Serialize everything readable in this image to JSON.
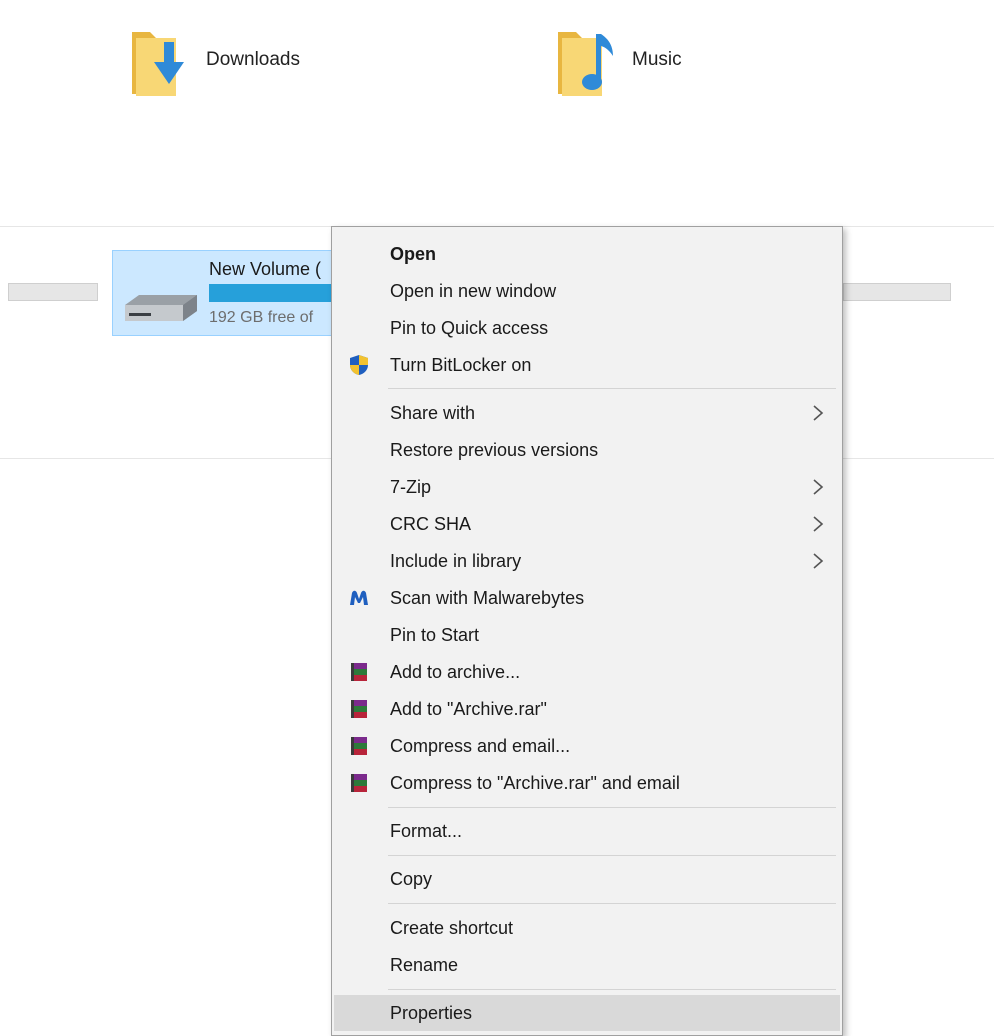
{
  "folders": [
    {
      "label": "Downloads",
      "icon": "downloads-folder-icon"
    },
    {
      "label": "Music",
      "icon": "music-folder-icon"
    }
  ],
  "drive": {
    "name": "New Volume (",
    "free_text": "192 GB free of",
    "icon": "hard-drive-icon",
    "used_fraction": 0.6
  },
  "context_menu": {
    "items": [
      {
        "label": "Open",
        "bold": true
      },
      {
        "label": "Open in new window"
      },
      {
        "label": "Pin to Quick access"
      },
      {
        "label": "Turn BitLocker on",
        "icon": "bitlocker-shield-icon"
      },
      {
        "label": "Share with",
        "submenu": true
      },
      {
        "label": "Restore previous versions"
      },
      {
        "label": "7-Zip",
        "submenu": true
      },
      {
        "label": "CRC SHA",
        "submenu": true
      },
      {
        "label": "Include in library",
        "submenu": true
      },
      {
        "label": "Scan with Malwarebytes",
        "icon": "malwarebytes-icon"
      },
      {
        "label": "Pin to Start"
      },
      {
        "label": "Add to archive...",
        "icon": "winrar-icon"
      },
      {
        "label": "Add to \"Archive.rar\"",
        "icon": "winrar-icon"
      },
      {
        "label": "Compress and email...",
        "icon": "winrar-icon"
      },
      {
        "label": "Compress to \"Archive.rar\" and email",
        "icon": "winrar-icon"
      },
      {
        "label": "Format..."
      },
      {
        "label": "Copy"
      },
      {
        "label": "Create shortcut"
      },
      {
        "label": "Rename"
      },
      {
        "label": "Properties",
        "highlighted": true
      }
    ]
  },
  "colors": {
    "selection_bg": "#cce8ff",
    "drive_bar": "#26a0da",
    "menu_bg": "#f2f2f2",
    "hover_bg": "#d9d9d9"
  }
}
